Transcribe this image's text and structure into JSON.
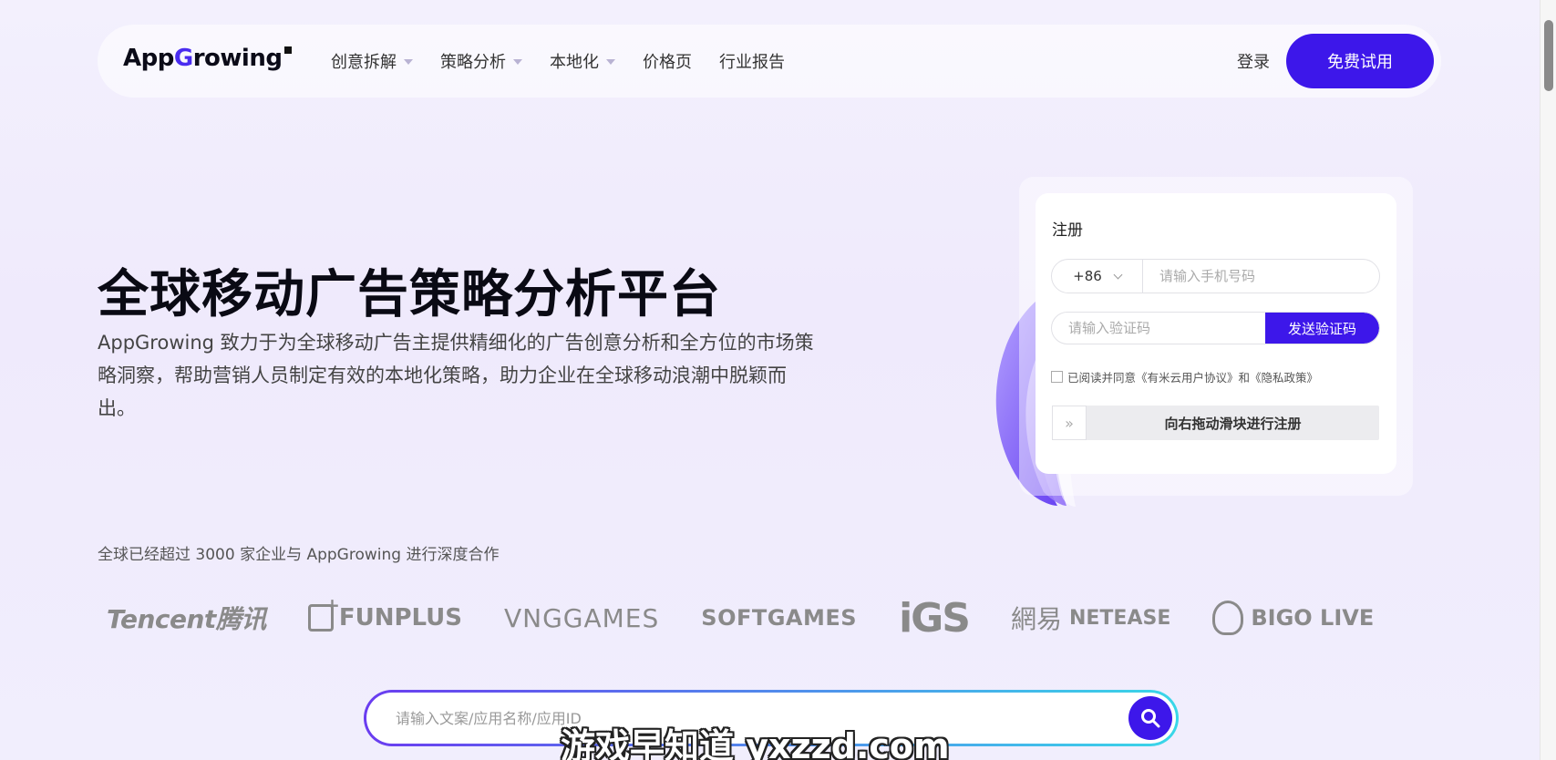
{
  "header": {
    "logo_text_before": "App",
    "logo_arrow": "G",
    "logo_text_after": "rowing",
    "menu": [
      {
        "label": "创意拆解",
        "has_dropdown": true
      },
      {
        "label": "策略分析",
        "has_dropdown": true
      },
      {
        "label": "本地化",
        "has_dropdown": true
      },
      {
        "label": "价格页",
        "has_dropdown": false
      },
      {
        "label": "行业报告",
        "has_dropdown": false
      }
    ],
    "login_label": "登录",
    "trial_label": "免费试用"
  },
  "hero": {
    "title": "全球移动广告策略分析平台",
    "description": "AppGrowing 致力于为全球移动广告主提供精细化的广告创意分析和全方位的市场策略洞察，帮助营销人员制定有效的本地化策略，助力企业在全球移动浪潮中脱颖而出。"
  },
  "register": {
    "title": "注册",
    "country_code": "+86",
    "phone_placeholder": "请输入手机号码",
    "code_placeholder": "请输入验证码",
    "send_code_label": "发送验证码",
    "agreement_text": "已阅读并同意《有米云用户协议》和《隐私政策》",
    "slider_handle": "»",
    "slider_label": "向右拖动滑块进行注册"
  },
  "partners": {
    "text": "全球已经超过 3000 家企业与 AppGrowing 进行深度合作",
    "logos": {
      "tencent": "Tencent腾讯",
      "funplus": "FUNPLUS",
      "vng": "VNGGAMES",
      "softgames": "SOFTGAMES",
      "igs": "iGS",
      "netease_cn": "網易",
      "netease_en": "NETEASE",
      "bigo": "BIGO LIVE"
    }
  },
  "search": {
    "placeholder": "请输入文案/应用名称/应用ID"
  },
  "watermark": "游戏早知道 yxzzd.com",
  "colors": {
    "accent": "#3d17ea",
    "gradient_start": "#6a3cf0",
    "gradient_end": "#39d7e8"
  }
}
